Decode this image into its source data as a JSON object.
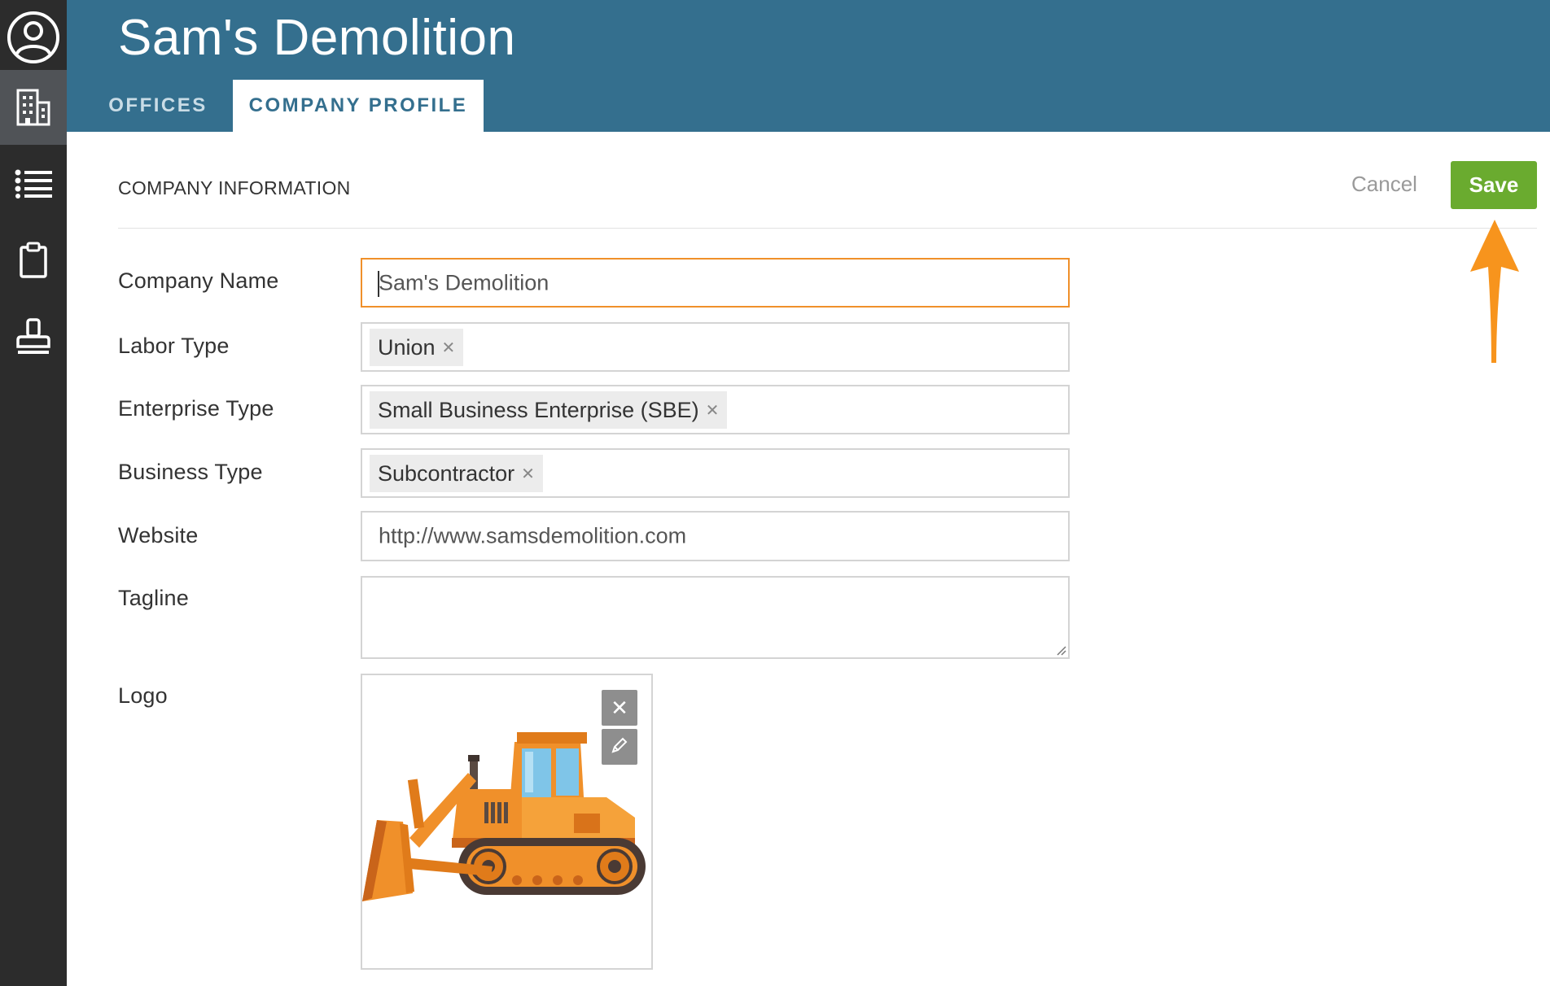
{
  "header": {
    "title": "Sam's Demolition",
    "tabs": [
      {
        "label": "OFFICES",
        "active": false
      },
      {
        "label": "COMPANY PROFILE",
        "active": true
      }
    ]
  },
  "sidebar": {
    "items": [
      {
        "icon": "user-circle-icon",
        "active": false
      },
      {
        "icon": "building-icon",
        "active": true
      },
      {
        "icon": "list-icon",
        "active": false
      },
      {
        "icon": "clipboard-icon",
        "active": false
      },
      {
        "icon": "stamp-icon",
        "active": false
      }
    ]
  },
  "section": {
    "title": "COMPANY INFORMATION",
    "cancel_label": "Cancel",
    "save_label": "Save"
  },
  "form": {
    "company_name": {
      "label": "Company Name",
      "value": "Sam's Demolition"
    },
    "labor_type": {
      "label": "Labor Type",
      "tags": [
        "Union"
      ]
    },
    "enterprise_type": {
      "label": "Enterprise Type",
      "tags": [
        "Small Business Enterprise (SBE)"
      ]
    },
    "business_type": {
      "label": "Business Type",
      "tags": [
        "Subcontractor"
      ]
    },
    "website": {
      "label": "Website",
      "value": "http://www.samsdemolition.com"
    },
    "tagline": {
      "label": "Tagline",
      "value": ""
    },
    "logo": {
      "label": "Logo",
      "image": "bulldozer-illustration"
    }
  },
  "annotation": {
    "color": "#f7941d",
    "target": "save-button"
  },
  "colors": {
    "header": "#346f8e",
    "sidebar": "#2c2c2c",
    "save": "#6aab2f",
    "focus": "#f0902a"
  }
}
